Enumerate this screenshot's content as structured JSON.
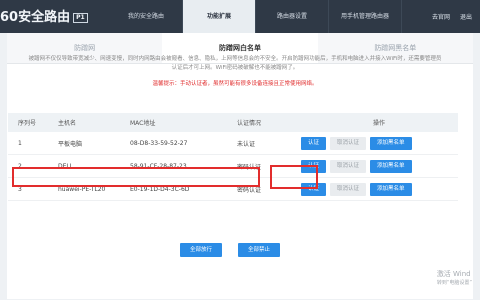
{
  "header": {
    "logo_text": "60安全路由",
    "logo_badge": "P1",
    "nav": [
      {
        "label": "我的安全路由"
      },
      {
        "label": "功能扩展",
        "active": true
      },
      {
        "label": "路由器设置"
      },
      {
        "label": "用手机管理路由器"
      }
    ],
    "user": "去官网",
    "logout": "退出"
  },
  "tabs": [
    {
      "label": "防蹭网"
    },
    {
      "label": "防蹭网白名单",
      "active": true
    },
    {
      "label": "防蹭网黑名单"
    }
  ],
  "description": "被蹭网不仅仅导致带宽减少、网速变慢，同时内网路由会被窥看、信息、隐私，上网等信息会的不安全。开启防蹭网功能后，手机和电脑进入并接入WiFi时，还需要管理员认证后才可上网。WiFi密码被破解也不能被蹭网了。",
  "warning": "温馨提示：手动认证者，虽然可能有很多设备连接且正常使用网络。",
  "table": {
    "headers": [
      "序列号",
      "主机名",
      "MAC地址",
      "认证情况",
      "操作"
    ],
    "rows": [
      {
        "index": "1",
        "host": "平板电脑",
        "mac": "08-D8-33-59-52-27",
        "status": "未认证",
        "btn1": "认证",
        "btn2": "取消认证",
        "btn3": "添加黑名单"
      },
      {
        "index": "2",
        "host": "DELL",
        "mac": "58-91-CF-28-87-23",
        "status": "密码认证",
        "btn1": "认证",
        "btn2": "取消认证",
        "btn3": "添加黑名单"
      },
      {
        "index": "3",
        "host": "huawei-PE-TL20",
        "mac": "E0-19-1D-D4-3C-6D",
        "status": "密码认证",
        "btn1": "认证",
        "btn2": "取消认证",
        "btn3": "添加黑名单"
      }
    ]
  },
  "bottom_buttons": {
    "allow_all": "全部放行",
    "block_all": "全部禁止"
  },
  "watermark": {
    "line1": "激活 Wind",
    "line2": "转到“电脑设置”"
  }
}
